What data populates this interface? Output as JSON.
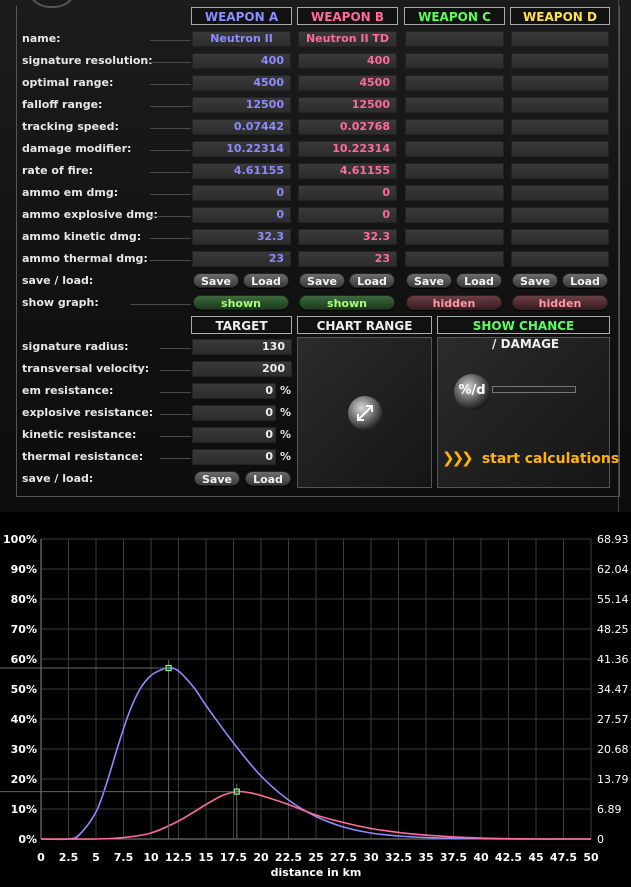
{
  "weapons": [
    {
      "header": "WEAPON A",
      "color": "#8c8cff",
      "name": "Neutron II",
      "signature_resolution": "400",
      "optimal_range": "4500",
      "falloff_range": "12500",
      "tracking_speed": "0.07442",
      "damage_modifier": "10.22314",
      "rate_of_fire": "4.61155",
      "ammo_em_dmg": "0",
      "ammo_explosive_dmg": "0",
      "ammo_kinetic_dmg": "32.3",
      "ammo_thermal_dmg": "23",
      "save": "Save",
      "load": "Load",
      "graph": "shown"
    },
    {
      "header": "WEAPON B",
      "color": "#ff6b9a",
      "name": "Neutron II TD",
      "signature_resolution": "400",
      "optimal_range": "4500",
      "falloff_range": "12500",
      "tracking_speed": "0.02768",
      "damage_modifier": "10.22314",
      "rate_of_fire": "4.61155",
      "ammo_em_dmg": "0",
      "ammo_explosive_dmg": "0",
      "ammo_kinetic_dmg": "32.3",
      "ammo_thermal_dmg": "23",
      "save": "Save",
      "load": "Load",
      "graph": "shown"
    },
    {
      "header": "WEAPON C",
      "color": "#57ff57",
      "name": "",
      "signature_resolution": "",
      "optimal_range": "",
      "falloff_range": "",
      "tracking_speed": "",
      "damage_modifier": "",
      "rate_of_fire": "",
      "ammo_em_dmg": "",
      "ammo_explosive_dmg": "",
      "ammo_kinetic_dmg": "",
      "ammo_thermal_dmg": "",
      "save": "Save",
      "load": "Load",
      "graph": "hidden"
    },
    {
      "header": "WEAPON D",
      "color": "#ffe14a",
      "name": "",
      "signature_resolution": "",
      "optimal_range": "",
      "falloff_range": "",
      "tracking_speed": "",
      "damage_modifier": "",
      "rate_of_fire": "",
      "ammo_em_dmg": "",
      "ammo_explosive_dmg": "",
      "ammo_kinetic_dmg": "",
      "ammo_thermal_dmg": "",
      "save": "Save",
      "load": "Load",
      "graph": "hidden"
    }
  ],
  "labels": {
    "name": "name:",
    "signature_resolution": "signature resolution:",
    "optimal_range": "optimal range:",
    "falloff_range": "falloff range:",
    "tracking_speed": "tracking speed:",
    "damage_modifier": "damage modifier:",
    "rate_of_fire": "rate of fire:",
    "ammo_em_dmg": "ammo em dmg:",
    "ammo_explosive_dmg": "ammo explosive dmg:",
    "ammo_kinetic_dmg": "ammo kinetic dmg:",
    "ammo_thermal_dmg": "ammo thermal dmg:",
    "save_load": "save / load:",
    "show_graph": "show graph:"
  },
  "target": {
    "header": "TARGET",
    "labels": {
      "signature_radius": "signature radius:",
      "transversal_velocity": "transversal velocity:",
      "em_resistance": "em resistance:",
      "explosive_resistance": "explosive resistance:",
      "kinetic_resistance": "kinetic resistance:",
      "thermal_resistance": "thermal resistance:",
      "save_load": "save / load:"
    },
    "signature_radius": "130",
    "transversal_velocity": "200",
    "em_resistance": "0",
    "explosive_resistance": "0",
    "kinetic_resistance": "0",
    "thermal_resistance": "0",
    "unit": "%",
    "save": "Save",
    "load": "Load"
  },
  "chart_range": {
    "header": "CHART RANGE"
  },
  "show": {
    "chance": "SHOW CHANCE",
    "sep": " / ",
    "damage": "DAMAGE",
    "toggle_icon": "%/d",
    "start": "start calculations"
  },
  "chart_data": {
    "type": "line",
    "xlabel": "distance in km",
    "x_ticks": [
      "0",
      "2.5",
      "5",
      "7.5",
      "10",
      "12.5",
      "15",
      "17.5",
      "20",
      "22.5",
      "25",
      "27.5",
      "30",
      "32.5",
      "35",
      "37.5",
      "40",
      "42.5",
      "45",
      "47.5",
      "50"
    ],
    "y_left_ticks": [
      "0%",
      "10%",
      "20%",
      "30%",
      "40%",
      "50%",
      "60%",
      "70%",
      "80%",
      "90%",
      "100%"
    ],
    "y_right_ticks": [
      "0",
      "6.89",
      "13.79",
      "20.68",
      "27.57",
      "34.47",
      "41.36",
      "48.25",
      "55.14",
      "62.04",
      "68.93"
    ],
    "xlim": [
      0,
      50
    ],
    "ylim": [
      0,
      100
    ],
    "grid": true,
    "series": [
      {
        "color": "#8c8cff",
        "x": [
          0,
          2.5,
          3.5,
          5,
          6,
          7,
          8,
          9,
          10,
          11,
          11.6,
          12.5,
          14,
          15,
          17.5,
          20,
          22.5,
          25,
          27.5,
          30,
          32.5,
          35,
          37.5,
          40,
          42.5,
          45,
          47.5,
          50
        ],
        "y": [
          0,
          0,
          1.5,
          9,
          19,
          31,
          42,
          50,
          54.5,
          56.5,
          57,
          56,
          50,
          44.5,
          32,
          21,
          13,
          7.5,
          4,
          2,
          1,
          0.5,
          0.2,
          0.1,
          0,
          0,
          0,
          0
        ]
      },
      {
        "color": "#ff6b9a",
        "x": [
          0,
          5,
          7.5,
          10,
          12.5,
          15,
          16.5,
          17.8,
          19,
          20,
          22.5,
          25,
          27.5,
          30,
          32.5,
          35,
          37.5,
          40,
          42.5,
          45,
          47.5,
          50
        ],
        "y": [
          0,
          0,
          0.5,
          2,
          6,
          11.5,
          14.5,
          15.8,
          15.4,
          14.5,
          11.5,
          8,
          5.5,
          3.5,
          2.2,
          1.3,
          0.7,
          0.3,
          0.1,
          0,
          0,
          0
        ]
      }
    ],
    "markers": [
      {
        "x": 11.6,
        "y": 57
      },
      {
        "x": 17.8,
        "y": 15.8
      }
    ]
  }
}
